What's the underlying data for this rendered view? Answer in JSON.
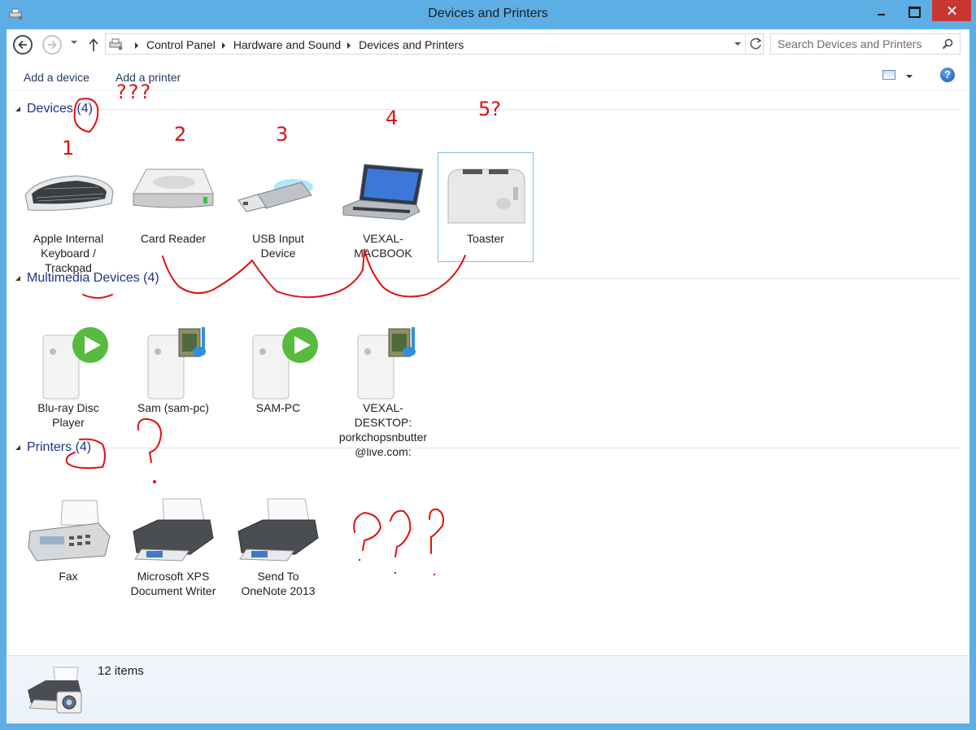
{
  "window": {
    "title": "Devices and Printers"
  },
  "nav": {
    "breadcrumbs": [
      "Control Panel",
      "Hardware and Sound",
      "Devices and Printers"
    ],
    "search_placeholder": "Search Devices and Printers"
  },
  "commands": {
    "add_device": "Add a device",
    "add_printer": "Add a printer"
  },
  "groups": {
    "devices": {
      "title": "Devices",
      "count": "(4)",
      "items": [
        {
          "label": "Apple Internal Keyboard / Trackpad",
          "icon": "keyboard-icon"
        },
        {
          "label": "Card Reader",
          "icon": "drive-icon"
        },
        {
          "label": "USB Input Device",
          "icon": "usb-drive-icon"
        },
        {
          "label": "VEXAL-MACBOOK",
          "icon": "laptop-icon"
        },
        {
          "label": "Toaster",
          "icon": "toaster-icon"
        }
      ]
    },
    "multimedia": {
      "title": "Multimedia Devices",
      "count": "(4)",
      "items": [
        {
          "label": "Blu-ray Disc Player",
          "icon": "media-player-icon"
        },
        {
          "label": "Sam (sam-pc)",
          "icon": "media-server-icon"
        },
        {
          "label": "SAM-PC",
          "icon": "media-player-icon"
        },
        {
          "label": "VEXAL-DESKTOP: porkchopsnbutter@live.com:",
          "icon": "media-server-icon"
        }
      ]
    },
    "printers": {
      "title": "Printers",
      "count": "(4)",
      "items": [
        {
          "label": "Fax",
          "icon": "fax-icon"
        },
        {
          "label": "Microsoft XPS Document Writer",
          "icon": "printer-icon"
        },
        {
          "label": "Send To OneNote 2013",
          "icon": "printer-icon"
        }
      ]
    }
  },
  "status": {
    "item_count": "12 items"
  },
  "annotations": {
    "n1": "1",
    "n2": "2",
    "n3": "3",
    "n4": "4",
    "n5": "5?",
    "q_printer": "???"
  },
  "colors": {
    "titlebar": "#5eaee6",
    "close_button": "#c7372f",
    "group_title": "#1e3287",
    "annotation": "#e01010"
  }
}
